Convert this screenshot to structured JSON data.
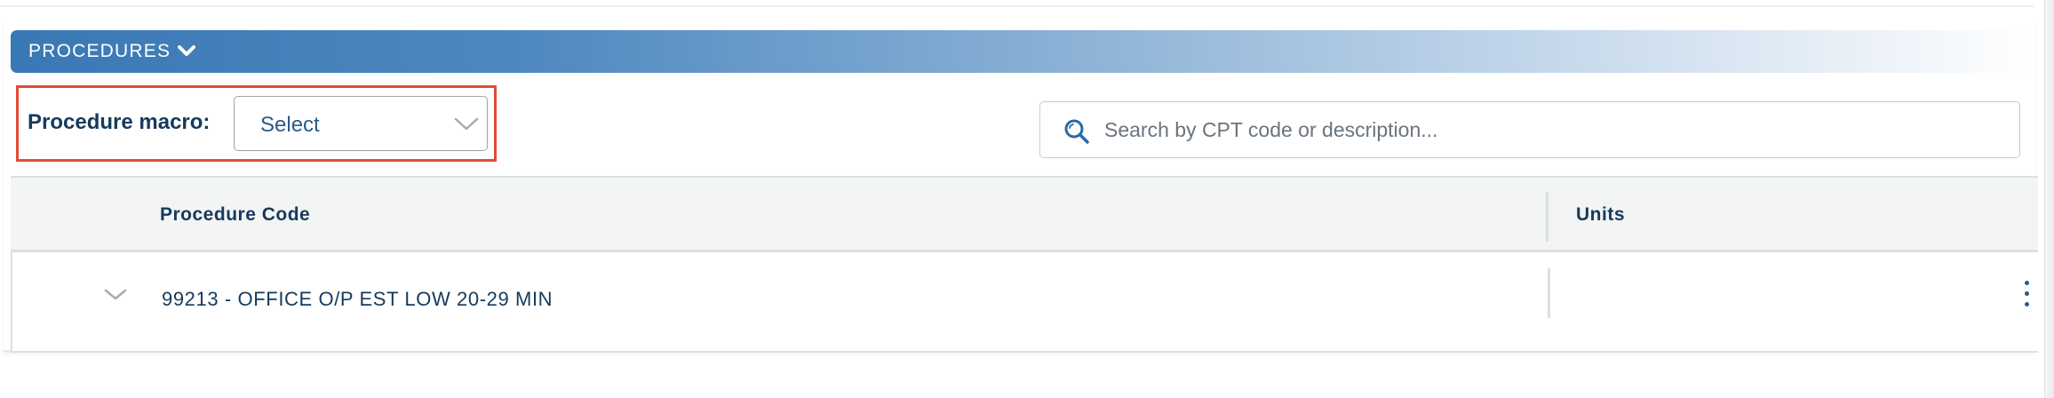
{
  "procedures": {
    "header_title": "PROCEDURES",
    "macro": {
      "label": "Procedure macro:",
      "selected": "Select"
    },
    "search": {
      "placeholder": "Search by CPT code or description..."
    },
    "table": {
      "columns": [
        "Procedure Code",
        "Units"
      ],
      "rows": [
        {
          "code": "99213 - OFFICE O/P EST LOW 20-29 MIN",
          "units": ""
        }
      ]
    }
  },
  "colors": {
    "header_start": "#3a78b5",
    "text_primary": "#163a5c",
    "highlight_border": "#e24a35"
  },
  "icons": [
    "chevron-down-icon",
    "search-icon",
    "kebab-menu-icon"
  ]
}
